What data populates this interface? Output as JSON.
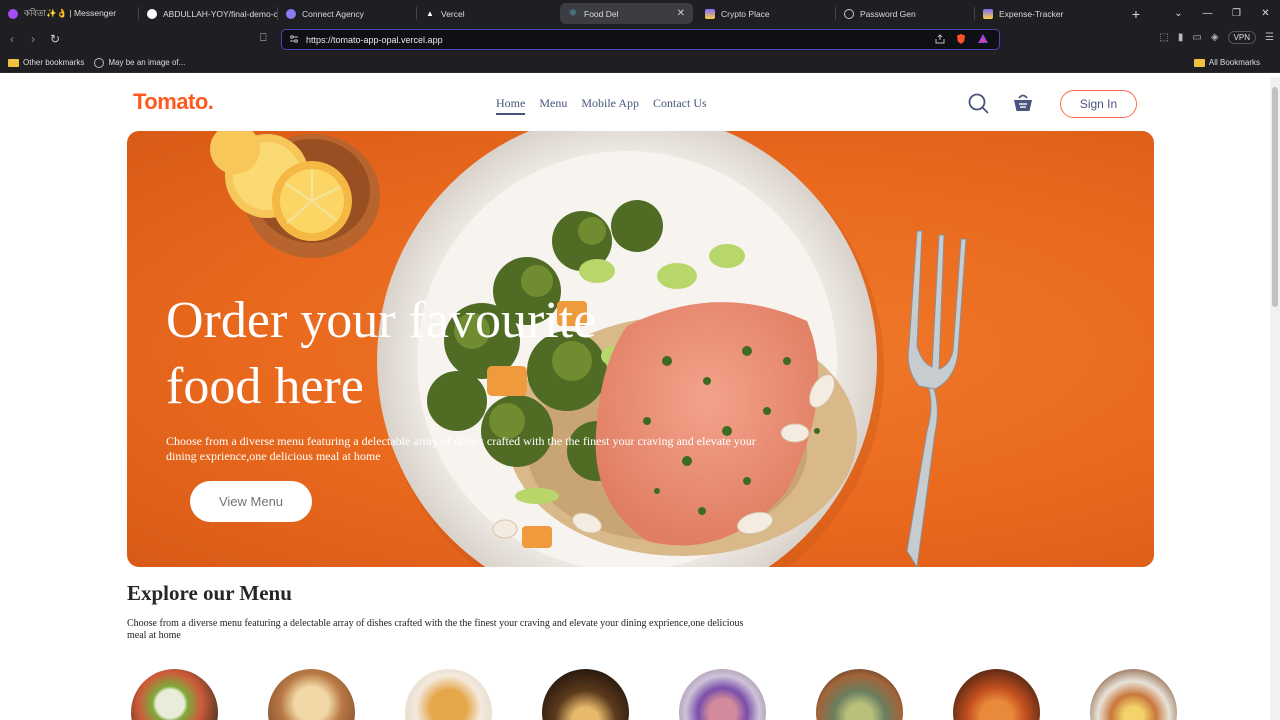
{
  "browser": {
    "tabs": [
      {
        "title": "কবিতা✨👌 | Messenger",
        "icon": "messenger-icon",
        "color": "#a14cf5"
      },
      {
        "title": "ABDULLAH-YOY/final-demo-c",
        "icon": "github-icon",
        "color": "#ffffff"
      },
      {
        "title": "Connect Agency",
        "icon": "connect-icon",
        "color": "#8a7cf5"
      },
      {
        "title": "Vercel",
        "icon": "vercel-icon",
        "color": "#ffffff"
      },
      {
        "title": "Food Del",
        "icon": "react-icon",
        "color": "#5ccfe6",
        "active": true
      },
      {
        "title": "Crypto Place",
        "icon": "vite-icon",
        "color": "#a46bf5"
      },
      {
        "title": "Password Gen",
        "icon": "globe-icon",
        "color": "#cccccc"
      },
      {
        "title": "Expense-Tracker",
        "icon": "vite-icon",
        "color": "#a46bf5"
      }
    ],
    "url": "https://tomato-app-opal.vercel.app",
    "vpn_label": "VPN",
    "bookmarks": {
      "other": "Other bookmarks",
      "image": "May be an image of...",
      "all": "All Bookmarks"
    }
  },
  "site": {
    "logo": "Tomato.",
    "nav": {
      "home": "Home",
      "menu": "Menu",
      "mobile": "Mobile App",
      "contact": "Contact Us"
    },
    "signin": "Sign In",
    "hero": {
      "title_line1": "Order your favourite",
      "title_line2": "food here",
      "description": "Choose from a diverse menu featuring a delectable array of dishes crafted with the the finest your craving and elevate your dining exprience,one delicious meal at home",
      "button": "View Menu"
    },
    "explore": {
      "title": "Explore our Menu",
      "description": "Choose from a diverse menu featuring a delectable array of dishes crafted with the the finest your craving and elevate your dining exprience,one delicious meal at home"
    },
    "colors": {
      "brand": "#ff5a1f",
      "hero_bg": "#e9691e",
      "nav_text": "#49557e"
    }
  }
}
